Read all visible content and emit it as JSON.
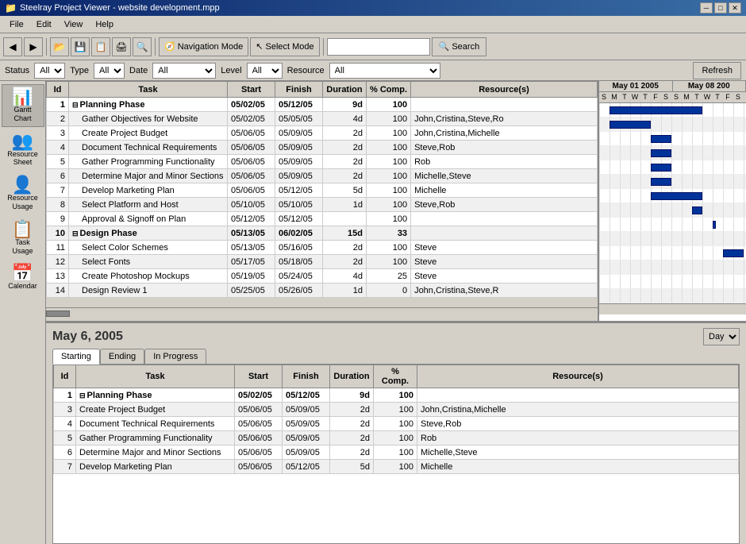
{
  "titleBar": {
    "title": "Steelray Project Viewer - website development.mpp",
    "minBtn": "─",
    "maxBtn": "□",
    "closeBtn": "✕"
  },
  "menuBar": {
    "items": [
      "File",
      "Edit",
      "View",
      "Help"
    ]
  },
  "toolbar": {
    "navModeLabel": "Navigation Mode",
    "selectModeLabel": "Select Mode",
    "searchPlaceholder": "",
    "searchLabel": "Search"
  },
  "filterBar": {
    "statusLabel": "Status",
    "statusValue": "All",
    "typeLabel": "Type",
    "typeValue": "All",
    "dateLabel": "Date",
    "dateValue": "All",
    "levelLabel": "Level",
    "levelValue": "All",
    "resourceLabel": "Resource",
    "resourceValue": "All",
    "refreshLabel": "Refresh"
  },
  "sidebar": {
    "items": [
      {
        "label": "Gantt\nChart",
        "icon": "📊"
      },
      {
        "label": "Resource\nSheet",
        "icon": "👥"
      },
      {
        "label": "Resource\nUsage",
        "icon": "👤"
      },
      {
        "label": "Task\nUsage",
        "icon": "📋"
      },
      {
        "label": "Calendar",
        "icon": "📅"
      }
    ]
  },
  "ganttHeader": {
    "week1": "May 01 2005",
    "week2": "May 08 200",
    "days": [
      "S",
      "M",
      "T",
      "W",
      "T",
      "F",
      "S",
      "S",
      "M",
      "T",
      "W",
      "T",
      "F",
      "S"
    ]
  },
  "topTable": {
    "columns": [
      "Id",
      "Task",
      "Start",
      "Finish",
      "Duration",
      "% Comp.",
      "Resource(s)"
    ],
    "rows": [
      {
        "id": "1",
        "indent": false,
        "bold": true,
        "collapse": true,
        "task": "Planning Phase",
        "start": "05/02/05",
        "finish": "05/12/05",
        "duration": "9d",
        "comp": "100",
        "resources": ""
      },
      {
        "id": "2",
        "indent": true,
        "bold": false,
        "collapse": false,
        "task": "Gather Objectives for Website",
        "start": "05/02/05",
        "finish": "05/05/05",
        "duration": "4d",
        "comp": "100",
        "resources": "John,Cristina,Steve,Ro"
      },
      {
        "id": "3",
        "indent": true,
        "bold": false,
        "collapse": false,
        "task": "Create Project Budget",
        "start": "05/06/05",
        "finish": "05/09/05",
        "duration": "2d",
        "comp": "100",
        "resources": "John,Cristina,Michelle"
      },
      {
        "id": "4",
        "indent": true,
        "bold": false,
        "collapse": false,
        "task": "Document Technical Requirements",
        "start": "05/06/05",
        "finish": "05/09/05",
        "duration": "2d",
        "comp": "100",
        "resources": "Steve,Rob"
      },
      {
        "id": "5",
        "indent": true,
        "bold": false,
        "collapse": false,
        "task": "Gather Programming Functionality",
        "start": "05/06/05",
        "finish": "05/09/05",
        "duration": "2d",
        "comp": "100",
        "resources": "Rob"
      },
      {
        "id": "6",
        "indent": true,
        "bold": false,
        "collapse": false,
        "task": "Determine Major and Minor Sections",
        "start": "05/06/05",
        "finish": "05/09/05",
        "duration": "2d",
        "comp": "100",
        "resources": "Michelle,Steve"
      },
      {
        "id": "7",
        "indent": true,
        "bold": false,
        "collapse": false,
        "task": "Develop Marketing Plan",
        "start": "05/06/05",
        "finish": "05/12/05",
        "duration": "5d",
        "comp": "100",
        "resources": "Michelle"
      },
      {
        "id": "8",
        "indent": true,
        "bold": false,
        "collapse": false,
        "task": "Select Platform and Host",
        "start": "05/10/05",
        "finish": "05/10/05",
        "duration": "1d",
        "comp": "100",
        "resources": "Steve,Rob"
      },
      {
        "id": "9",
        "indent": true,
        "bold": false,
        "collapse": false,
        "task": "Approval & Signoff on Plan",
        "start": "05/12/05",
        "finish": "05/12/05",
        "duration": "",
        "comp": "100",
        "resources": ""
      },
      {
        "id": "10",
        "indent": false,
        "bold": true,
        "collapse": true,
        "task": "Design Phase",
        "start": "05/13/05",
        "finish": "06/02/05",
        "duration": "15d",
        "comp": "33",
        "resources": ""
      },
      {
        "id": "11",
        "indent": true,
        "bold": false,
        "collapse": false,
        "task": "Select Color Schemes",
        "start": "05/13/05",
        "finish": "05/16/05",
        "duration": "2d",
        "comp": "100",
        "resources": "Steve"
      },
      {
        "id": "12",
        "indent": true,
        "bold": false,
        "collapse": false,
        "task": "Select Fonts",
        "start": "05/17/05",
        "finish": "05/18/05",
        "duration": "2d",
        "comp": "100",
        "resources": "Steve"
      },
      {
        "id": "13",
        "indent": true,
        "bold": false,
        "collapse": false,
        "task": "Create Photoshop Mockups",
        "start": "05/19/05",
        "finish": "05/24/05",
        "duration": "4d",
        "comp": "25",
        "resources": "Steve"
      },
      {
        "id": "14",
        "indent": true,
        "bold": false,
        "collapse": false,
        "task": "Design Review 1",
        "start": "05/25/05",
        "finish": "05/26/05",
        "duration": "1d",
        "comp": "0",
        "resources": "John,Cristina,Steve,R"
      }
    ]
  },
  "bottomPane": {
    "date": "May 6, 2005",
    "dayLabel": "Day",
    "tabs": [
      "Starting",
      "Ending",
      "In Progress"
    ],
    "activeTab": 0,
    "table": {
      "columns": [
        "Id",
        "Task",
        "Start",
        "Finish",
        "Duration",
        "% Comp.",
        "Resource(s)"
      ],
      "rows": [
        {
          "id": "1",
          "bold": true,
          "indent": false,
          "collapse": true,
          "task": "Planning Phase",
          "start": "05/02/05",
          "finish": "05/12/05",
          "duration": "9d",
          "comp": "100",
          "resources": ""
        },
        {
          "id": "3",
          "bold": false,
          "indent": true,
          "collapse": false,
          "task": "Create Project Budget",
          "start": "05/06/05",
          "finish": "05/09/05",
          "duration": "2d",
          "comp": "100",
          "resources": "John,Cristina,Michelle"
        },
        {
          "id": "4",
          "bold": false,
          "indent": true,
          "collapse": false,
          "task": "Document Technical Requirements",
          "start": "05/06/05",
          "finish": "05/09/05",
          "duration": "2d",
          "comp": "100",
          "resources": "Steve,Rob"
        },
        {
          "id": "5",
          "bold": false,
          "indent": true,
          "collapse": false,
          "task": "Gather Programming Functionality",
          "start": "05/06/05",
          "finish": "05/09/05",
          "duration": "2d",
          "comp": "100",
          "resources": "Rob"
        },
        {
          "id": "6",
          "bold": false,
          "indent": true,
          "collapse": false,
          "task": "Determine Major and Minor Sections",
          "start": "05/06/05",
          "finish": "05/09/05",
          "duration": "2d",
          "comp": "100",
          "resources": "Michelle,Steve"
        },
        {
          "id": "7",
          "bold": false,
          "indent": true,
          "collapse": false,
          "task": "Develop Marketing Plan",
          "start": "05/06/05",
          "finish": "05/12/05",
          "duration": "5d",
          "comp": "100",
          "resources": "Michelle"
        }
      ]
    }
  }
}
